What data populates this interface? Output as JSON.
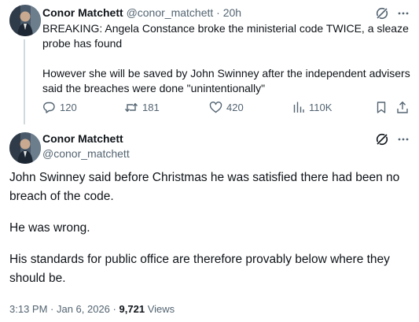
{
  "reply_to": {
    "author_name": "Conor Matchett",
    "handle": "@conor_matchett",
    "separator": "·",
    "time_ago": "20h",
    "text_paragraphs": [
      "BREAKING: Angela Constance broke the ministerial code TWICE, a sleaze probe has found",
      "However she will be saved by John Swinney after the independent advisers said the breaches were done \"unintentionally\""
    ],
    "stats": {
      "replies": "120",
      "reposts": "181",
      "likes": "420",
      "views": "110K"
    },
    "icons": {
      "grok": "grok-icon",
      "more": "more-icon",
      "reply": "reply-icon",
      "repost": "repost-icon",
      "like": "like-icon",
      "views": "views-icon",
      "bookmark": "bookmark-icon",
      "share": "share-icon"
    }
  },
  "main_tweet": {
    "author_name": "Conor Matchett",
    "handle": "@conor_matchett",
    "text_paragraphs": [
      "John Swinney said before Christmas he was satisfied there had been no breach of the code.",
      "He was wrong.",
      "His standards for public office are therefore provably below where they should be."
    ],
    "timestamp": "3:13 PM · Jan 6, 2026",
    "meta_separator": "·",
    "view_count": "9,721",
    "views_label": "Views"
  },
  "colors": {
    "text": "#0f1419",
    "muted": "#536471",
    "thread_line": "#cfd9de",
    "background": "#ffffff"
  }
}
